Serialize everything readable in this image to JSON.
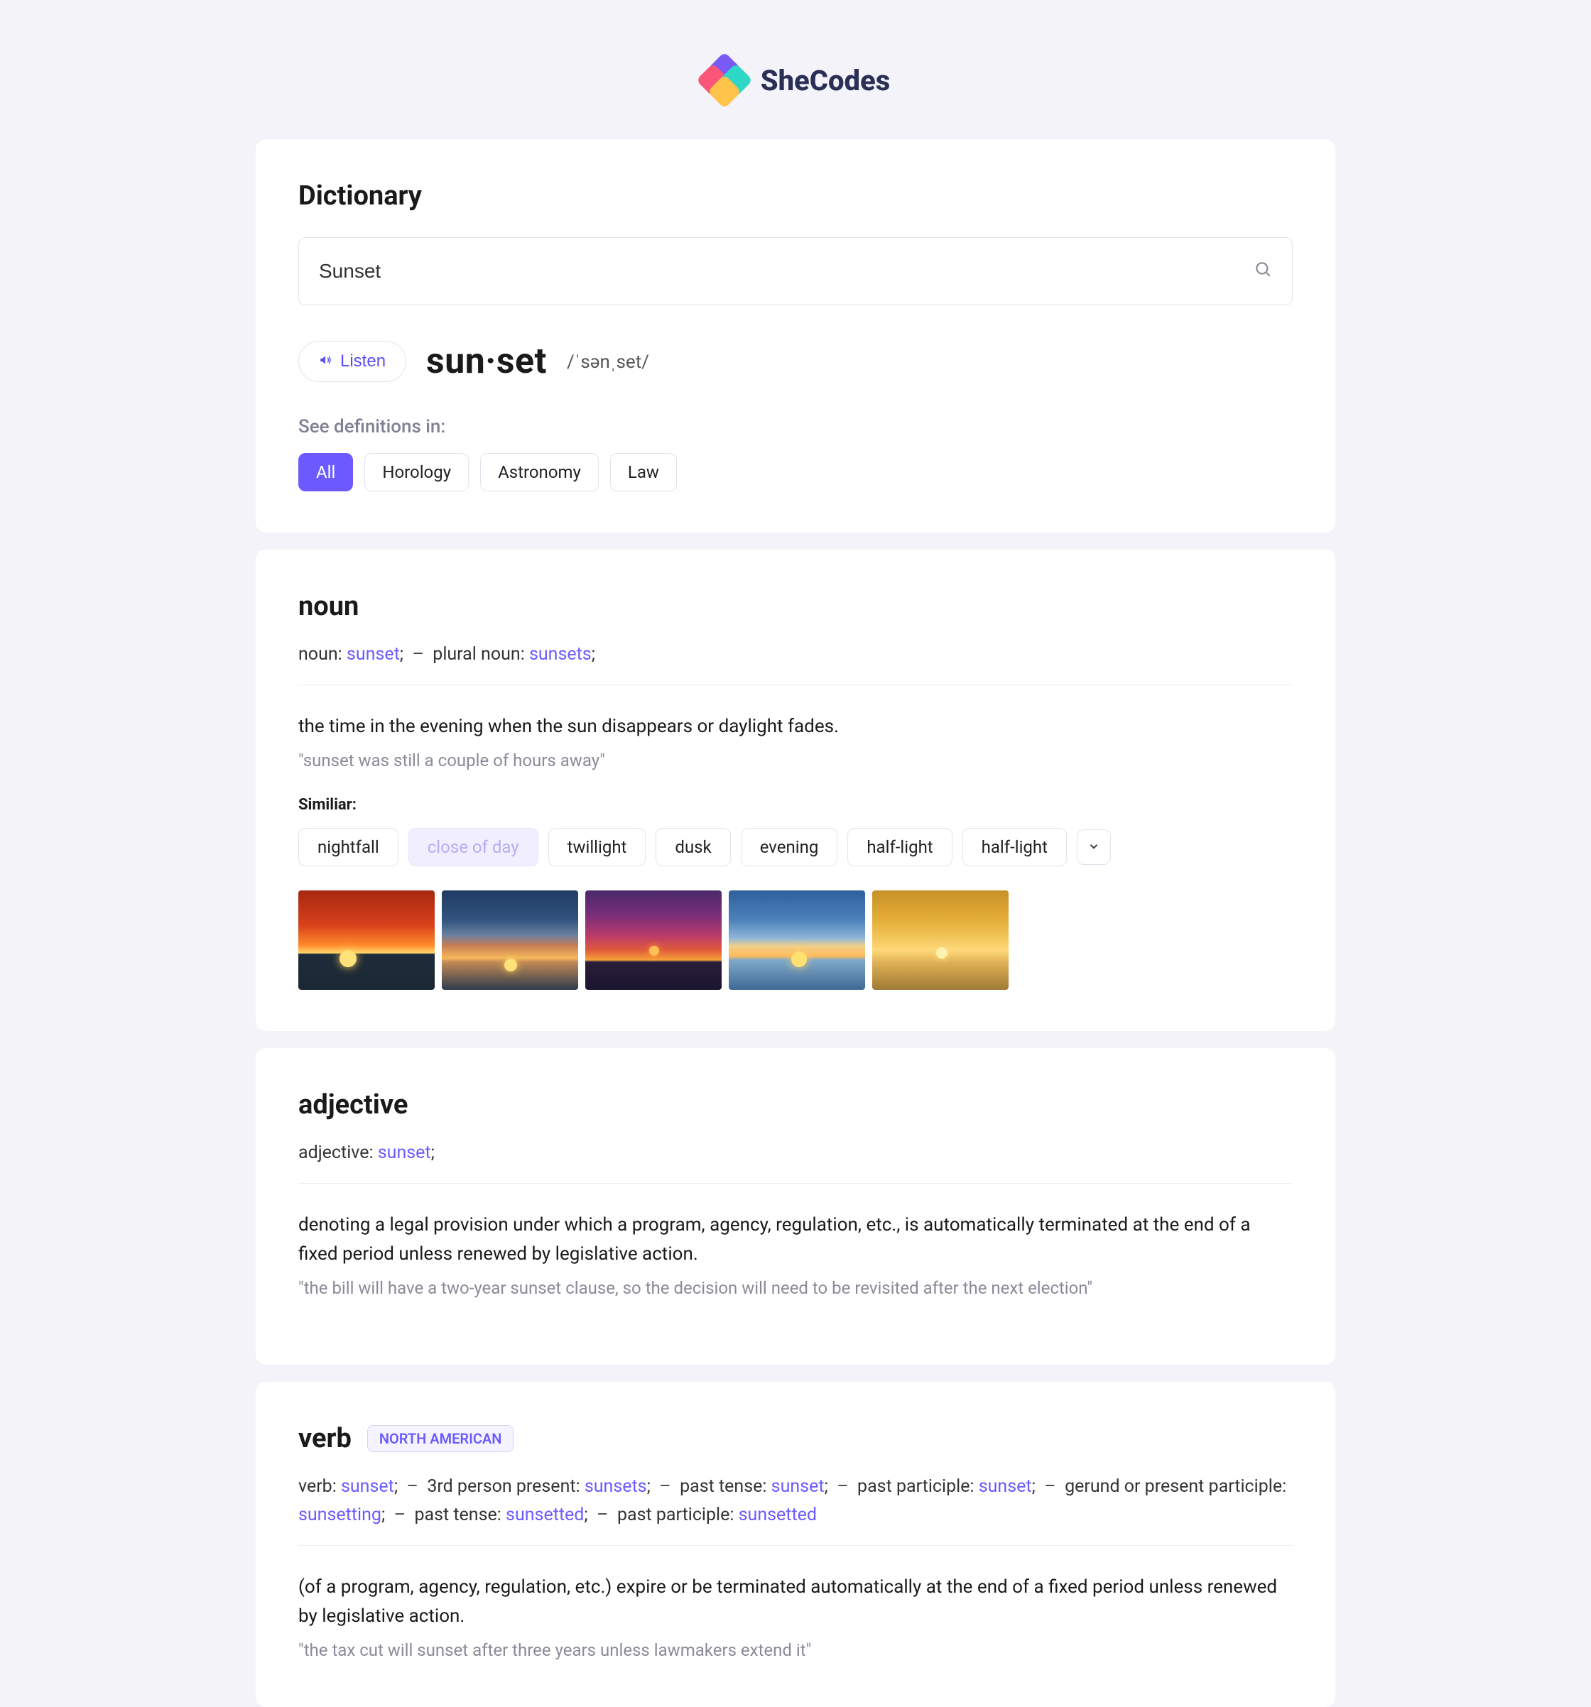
{
  "brand": {
    "name": "SheCodes"
  },
  "header": {
    "title": "Dictionary",
    "search_value": "Sunset",
    "listen_label": "Listen",
    "word": "sun·set",
    "phonetic": "/ˈsənˌset/"
  },
  "categories": {
    "label": "See definitions in:",
    "items": [
      "All",
      "Horology",
      "Astronomy",
      "Law"
    ],
    "active_index": 0
  },
  "sections": {
    "noun": {
      "heading": "noun",
      "forms": [
        {
          "label": "noun",
          "word": "sunset"
        },
        {
          "label": "plural noun",
          "word": "sunsets"
        }
      ],
      "definition": "the time in the evening when the sun disappears or daylight fades.",
      "example": "\"sunset was still a couple of hours away\"",
      "similar_label": "Similiar:",
      "similar": [
        "nightfall",
        "close of day",
        "twillight",
        "dusk",
        "evening",
        "half-light",
        "half-light"
      ],
      "muted_similar_index": 1
    },
    "adjective": {
      "heading": "adjective",
      "forms": [
        {
          "label": "adjective",
          "word": "sunset"
        }
      ],
      "definition": "denoting a legal provision under which a program, agency, regulation, etc., is automatically terminated at the end of a fixed period unless renewed by legislative action.",
      "example": "\"the bill will have a two-year sunset clause, so the decision will need to be revisited after the next election\""
    },
    "verb": {
      "heading": "verb",
      "tag": "NORTH AMERICAN",
      "forms": [
        {
          "label": "verb",
          "word": "sunset"
        },
        {
          "label": "3rd person present",
          "word": "sunsets"
        },
        {
          "label": "past tense",
          "word": "sunset"
        },
        {
          "label": "past participle",
          "word": "sunset"
        },
        {
          "label": "gerund or present participle",
          "word": "sunsetting"
        },
        {
          "label": "past tense",
          "word": "sunsetted"
        },
        {
          "label": "past participle",
          "word": "sunsetted"
        }
      ],
      "definition": "(of a program, agency, regulation, etc.) expire or be terminated automatically at the end of a fixed period unless renewed by legislative action.",
      "example": "\"the tax cut will sunset after three years unless lawmakers extend it\""
    }
  }
}
